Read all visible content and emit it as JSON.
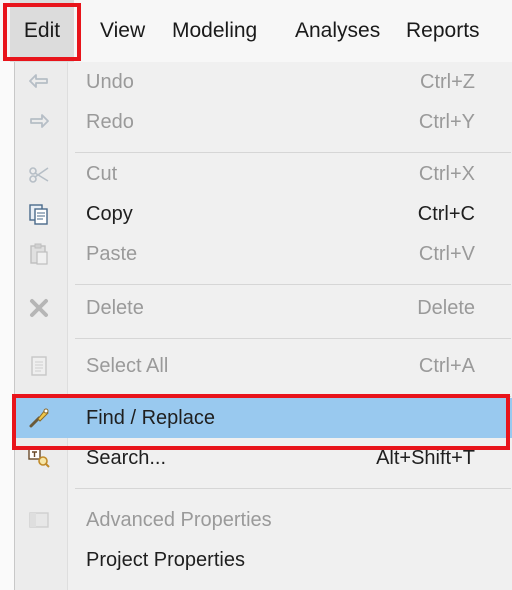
{
  "menubar": {
    "items": [
      {
        "label": "Edit"
      },
      {
        "label": "View"
      },
      {
        "label": "Modeling"
      },
      {
        "label": "Analyses"
      },
      {
        "label": "Reports"
      }
    ]
  },
  "menu": {
    "items": [
      {
        "label": "Undo",
        "shortcut": "Ctrl+Z",
        "icon": "undo-icon"
      },
      {
        "label": "Redo",
        "shortcut": "Ctrl+Y",
        "icon": "redo-icon"
      },
      {
        "label": "Cut",
        "shortcut": "Ctrl+X",
        "icon": "scissors-icon"
      },
      {
        "label": "Copy",
        "shortcut": "Ctrl+C",
        "icon": "copy-icon"
      },
      {
        "label": "Paste",
        "shortcut": "Ctrl+V",
        "icon": "paste-icon"
      },
      {
        "label": "Delete",
        "shortcut": "Delete",
        "icon": "delete-x-icon"
      },
      {
        "label": "Select All",
        "shortcut": "Ctrl+A",
        "icon": "select-all-icon"
      },
      {
        "label": "Find / Replace",
        "shortcut": "",
        "icon": "find-replace-icon"
      },
      {
        "label": "Search...",
        "shortcut": "Alt+Shift+T",
        "icon": "search-icon"
      },
      {
        "label": "Advanced Properties",
        "shortcut": "",
        "icon": "properties-icon"
      },
      {
        "label": "Project Properties",
        "shortcut": "",
        "icon": ""
      }
    ]
  },
  "colors": {
    "highlight": "#99c9ef",
    "callout_outline": "#e8141b",
    "disabled_text": "#9a9a9a"
  }
}
